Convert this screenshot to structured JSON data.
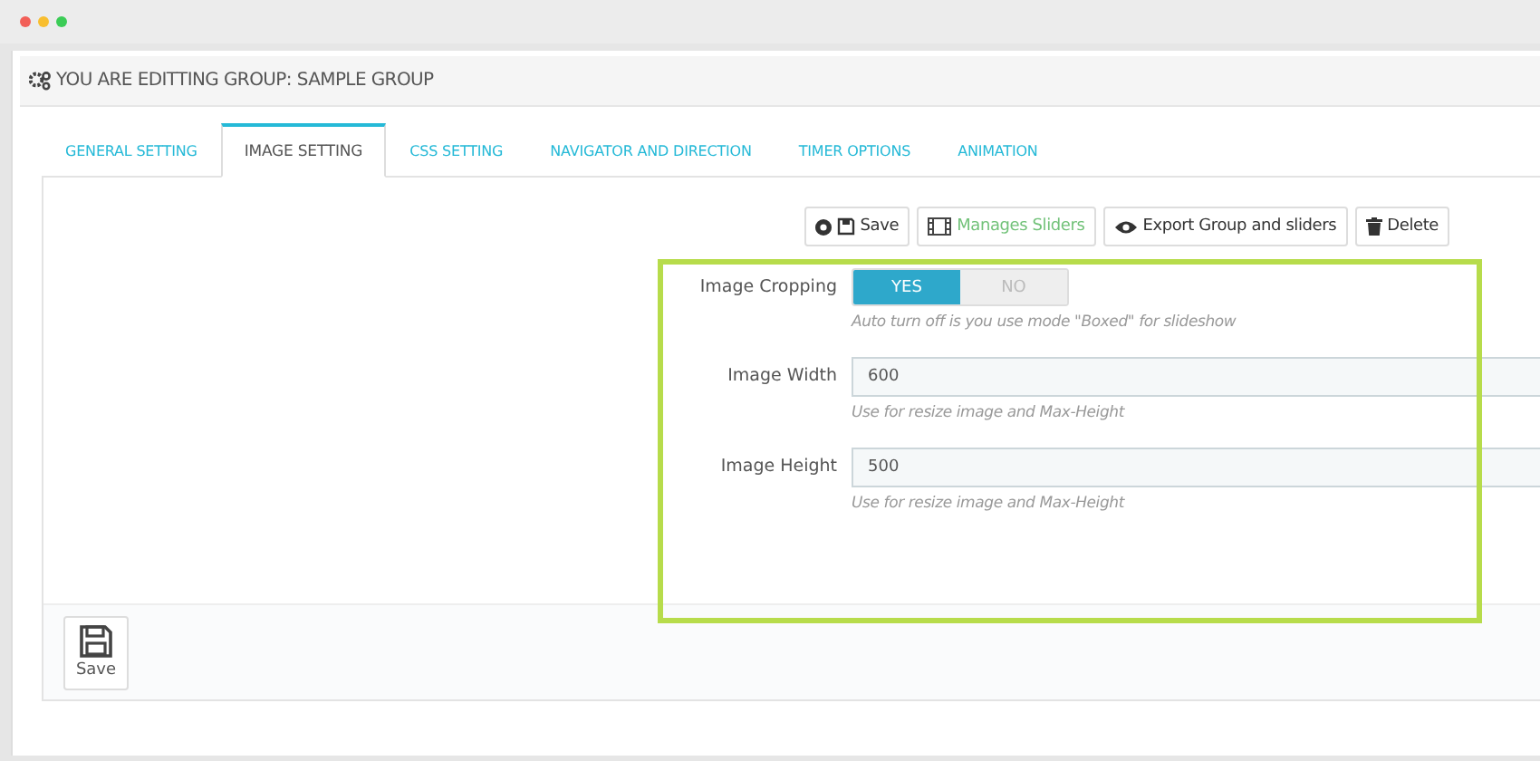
{
  "window": {
    "title": "YOU ARE EDITTING GROUP: SAMPLE GROUP"
  },
  "tabs": [
    {
      "label": "GENERAL SETTING",
      "selected": false
    },
    {
      "label": "IMAGE SETTING",
      "selected": true
    },
    {
      "label": "CSS SETTING",
      "selected": false
    },
    {
      "label": "NAVIGATOR AND DIRECTION",
      "selected": false
    },
    {
      "label": "TIMER OPTIONS",
      "selected": false
    },
    {
      "label": "ANIMATION",
      "selected": false
    }
  ],
  "toolbar": [
    {
      "kind": "save",
      "label": "Save"
    },
    {
      "kind": "sliders",
      "label": "Manages Sliders"
    },
    {
      "kind": "export",
      "label": "Export Group and sliders"
    },
    {
      "kind": "delete",
      "label": "Delete"
    }
  ],
  "fields": [
    {
      "kind": "toggle",
      "label": "Image Cropping",
      "options": [
        {
          "label": "YES",
          "selected": true
        },
        {
          "label": "NO",
          "selected": false
        }
      ],
      "help": "Auto turn off is you use mode \"Boxed\" for slideshow"
    },
    {
      "kind": "text",
      "label": "Image Width",
      "value": "600",
      "help": "Use for resize image and Max-Height"
    },
    {
      "kind": "text",
      "label": "Image Height",
      "value": "500",
      "help": "Use for resize image and Max-Height"
    }
  ],
  "footer": {
    "save_label": "Save"
  }
}
